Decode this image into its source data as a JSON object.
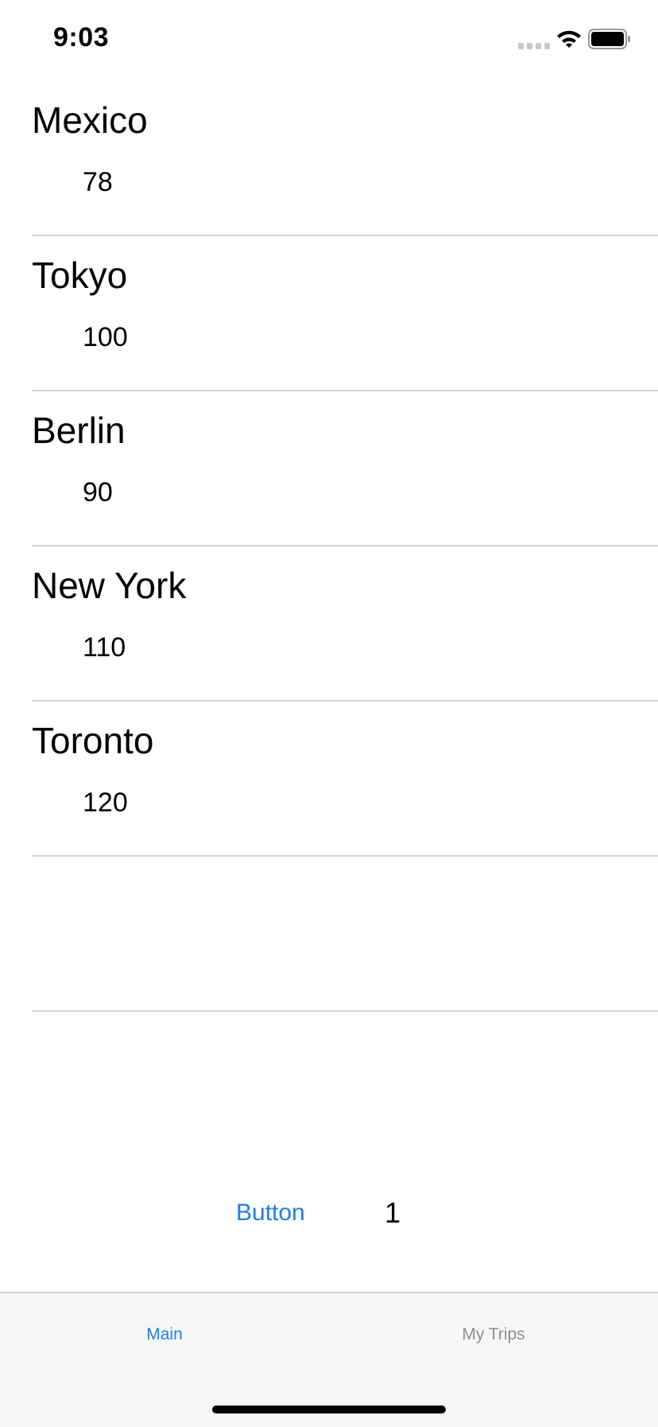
{
  "status_bar": {
    "time": "9:03"
  },
  "cities": [
    {
      "name": "Mexico",
      "value": "78"
    },
    {
      "name": "Tokyo",
      "value": "100"
    },
    {
      "name": "Berlin",
      "value": "90"
    },
    {
      "name": "New York",
      "value": "110"
    },
    {
      "name": "Toronto",
      "value": "120"
    },
    {
      "name": "",
      "value": ""
    }
  ],
  "actions": {
    "button_label": "Button",
    "counter": "1"
  },
  "tabs": [
    {
      "label": "Main",
      "selected": true
    },
    {
      "label": "My Trips",
      "selected": false
    }
  ],
  "colors": {
    "accent": "#1f7fe8",
    "inactive_tab": "#8e8e93"
  }
}
